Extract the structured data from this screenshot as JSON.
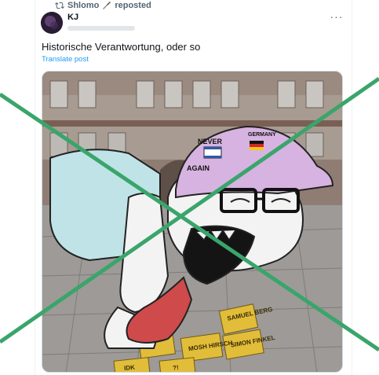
{
  "repost": {
    "user": "Shlomo",
    "action": "reposted"
  },
  "post": {
    "author_name": "KJ",
    "text": "Historische Verantwortung, oder so",
    "translate_label": "Translate post",
    "more_label": "···"
  },
  "image": {
    "cap_text_1": "NEVER",
    "cap_text_2": "AGAIN",
    "cap_text_3": "GERMANY",
    "stones": [
      "SAMUEL BERG",
      "SIMON FINKEL",
      "MOSH HIRSCH",
      "IDK",
      "?!"
    ]
  },
  "colors": {
    "accent": "#1d9bf0",
    "muted": "#536471",
    "cross": "#3aa56b"
  }
}
